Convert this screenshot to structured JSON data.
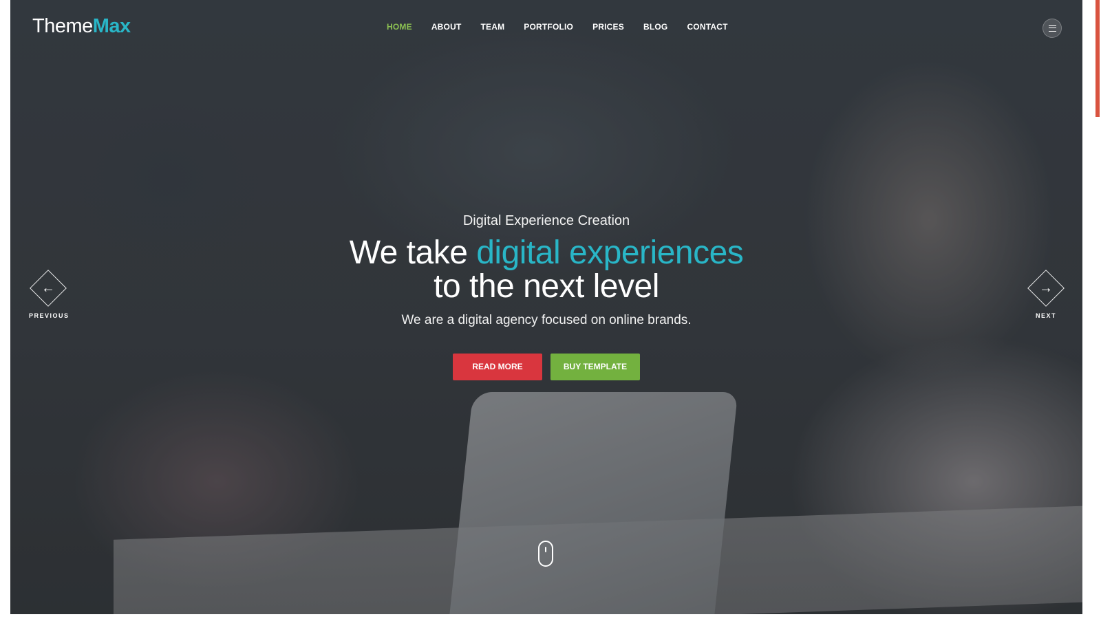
{
  "brand": {
    "logo_part1": "Theme",
    "logo_part2": "Max",
    "accent_color": "#29b6c7"
  },
  "nav": {
    "items": [
      {
        "label": "HOME",
        "active": true
      },
      {
        "label": "ABOUT"
      },
      {
        "label": "TEAM"
      },
      {
        "label": "PORTFOLIO"
      },
      {
        "label": "PRICES"
      },
      {
        "label": "BLOG"
      },
      {
        "label": "CONTACT"
      }
    ],
    "active_color": "#8cc152",
    "menu_icon": "hamburger-icon"
  },
  "hero": {
    "kicker": "Digital Experience Creation",
    "headline_part1": "We take ",
    "headline_highlight": "digital experiences",
    "headline_part2": "to the next level",
    "subtitle": "We are a digital agency focused on online brands.",
    "primary_button": "READ MORE",
    "secondary_button": "BUY TEMPLATE",
    "primary_color": "#d9363e",
    "secondary_color": "#73b13f"
  },
  "slider": {
    "prev_label": "PREVIOUS",
    "next_label": "NEXT",
    "prev_icon": "arrow-left-icon",
    "next_icon": "arrow-right-icon",
    "scroll_icon": "mouse-scroll-icon"
  }
}
